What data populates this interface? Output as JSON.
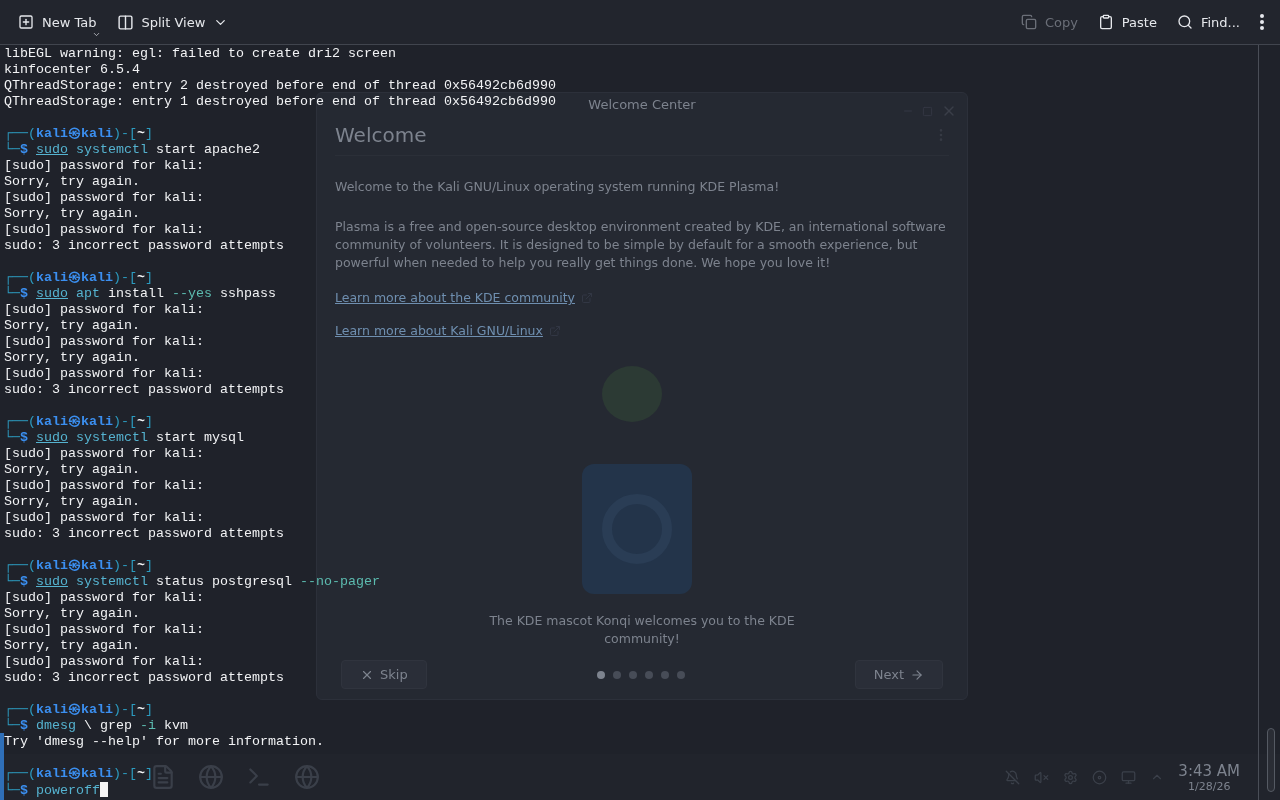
{
  "toolbar": {
    "new_tab": {
      "label": "New Tab"
    },
    "split_view": {
      "label": "Split View"
    },
    "actions": [
      {
        "kind": "copy",
        "label": "Copy",
        "disabled": true
      },
      {
        "kind": "paste",
        "label": "Paste",
        "disabled": false
      },
      {
        "kind": "find",
        "label": "Find...",
        "disabled": false
      }
    ]
  },
  "terminal": {
    "lines": [
      {
        "kind": "output",
        "text": "libEGL warning: egl: failed to create dri2 screen"
      },
      {
        "kind": "output",
        "text": "kinfocenter 6.5.4"
      },
      {
        "kind": "output",
        "text": "QThreadStorage: entry 2 destroyed before end of thread 0x56492cb6d990"
      },
      {
        "kind": "output",
        "text": "QThreadStorage: entry 1 destroyed before end of thread 0x56492cb6d990"
      },
      {
        "kind": "blank"
      },
      {
        "kind": "prompt",
        "open": "┌──(",
        "user": "kali㉿kali",
        "mid": ")-[",
        "dir": "~",
        "close": "]",
        "corner": "└─",
        "symbol": "$",
        "cursor": false,
        "command": [
          {
            "kind": "sudo",
            "text": "sudo"
          },
          {
            "kind": "program",
            "text": "systemctl"
          },
          {
            "kind": "arg",
            "text": "start apache2"
          }
        ]
      },
      {
        "kind": "output",
        "text": "[sudo] password for kali:"
      },
      {
        "kind": "output",
        "text": "Sorry, try again."
      },
      {
        "kind": "output",
        "text": "[sudo] password for kali:"
      },
      {
        "kind": "output",
        "text": "Sorry, try again."
      },
      {
        "kind": "output",
        "text": "[sudo] password for kali:"
      },
      {
        "kind": "output",
        "text": "sudo: 3 incorrect password attempts"
      },
      {
        "kind": "blank"
      },
      {
        "kind": "prompt",
        "open": "┌──(",
        "user": "kali㉿kali",
        "mid": ")-[",
        "dir": "~",
        "close": "]",
        "corner": "└─",
        "symbol": "$",
        "cursor": false,
        "command": [
          {
            "kind": "sudo",
            "text": "sudo"
          },
          {
            "kind": "program",
            "text": "apt"
          },
          {
            "kind": "arg",
            "text": "install"
          },
          {
            "kind": "option",
            "text": "--yes"
          },
          {
            "kind": "arg",
            "text": "sshpass"
          }
        ]
      },
      {
        "kind": "output",
        "text": "[sudo] password for kali:"
      },
      {
        "kind": "output",
        "text": "Sorry, try again."
      },
      {
        "kind": "output",
        "text": "[sudo] password for kali:"
      },
      {
        "kind": "output",
        "text": "Sorry, try again."
      },
      {
        "kind": "output",
        "text": "[sudo] password for kali:"
      },
      {
        "kind": "output",
        "text": "sudo: 3 incorrect password attempts"
      },
      {
        "kind": "blank"
      },
      {
        "kind": "prompt",
        "open": "┌──(",
        "user": "kali㉿kali",
        "mid": ")-[",
        "dir": "~",
        "close": "]",
        "corner": "└─",
        "symbol": "$",
        "cursor": false,
        "command": [
          {
            "kind": "sudo",
            "text": "sudo"
          },
          {
            "kind": "program",
            "text": "systemctl"
          },
          {
            "kind": "arg",
            "text": "start mysql"
          }
        ]
      },
      {
        "kind": "output",
        "text": "[sudo] password for kali:"
      },
      {
        "kind": "output",
        "text": "Sorry, try again."
      },
      {
        "kind": "output",
        "text": "[sudo] password for kali:"
      },
      {
        "kind": "output",
        "text": "Sorry, try again."
      },
      {
        "kind": "output",
        "text": "[sudo] password for kali:"
      },
      {
        "kind": "output",
        "text": "sudo: 3 incorrect password attempts"
      },
      {
        "kind": "blank"
      },
      {
        "kind": "prompt",
        "open": "┌──(",
        "user": "kali㉿kali",
        "mid": ")-[",
        "dir": "~",
        "close": "]",
        "corner": "└─",
        "symbol": "$",
        "cursor": false,
        "command": [
          {
            "kind": "sudo",
            "text": "sudo"
          },
          {
            "kind": "program",
            "text": "systemctl"
          },
          {
            "kind": "arg",
            "text": "status postgresql"
          },
          {
            "kind": "option",
            "text": "--no-pager"
          }
        ]
      },
      {
        "kind": "output",
        "text": "[sudo] password for kali:"
      },
      {
        "kind": "output",
        "text": "Sorry, try again."
      },
      {
        "kind": "output",
        "text": "[sudo] password for kali:"
      },
      {
        "kind": "output",
        "text": "Sorry, try again."
      },
      {
        "kind": "output",
        "text": "[sudo] password for kali:"
      },
      {
        "kind": "output",
        "text": "sudo: 3 incorrect password attempts"
      },
      {
        "kind": "blank"
      },
      {
        "kind": "prompt",
        "open": "┌──(",
        "user": "kali㉿kali",
        "mid": ")-[",
        "dir": "~",
        "close": "]",
        "corner": "└─",
        "symbol": "$",
        "cursor": false,
        "command": [
          {
            "kind": "program",
            "text": "dmesg"
          },
          {
            "kind": "arg",
            "text": "\\ grep"
          },
          {
            "kind": "option",
            "text": "-i"
          },
          {
            "kind": "arg",
            "text": "kvm"
          }
        ]
      },
      {
        "kind": "output",
        "text": "Try 'dmesg --help' for more information."
      },
      {
        "kind": "blank"
      },
      {
        "kind": "prompt",
        "open": "┌──(",
        "user": "kali㉿kali",
        "mid": ")-[",
        "dir": "~",
        "close": "]",
        "corner": "└─",
        "symbol": "$",
        "cursor": true,
        "command": [
          {
            "kind": "program",
            "text": "poweroff"
          }
        ]
      }
    ]
  },
  "welcome_window": {
    "title": "Welcome Center",
    "heading": "Welcome",
    "paragraphs": [
      "Welcome to the Kali GNU/Linux operating system running KDE Plasma!",
      "Plasma is a free and open-source desktop environment created by KDE, an international software community of volunteers. It is designed to be simple by default for a smooth experience, but powerful when needed to help you really get things done. We hope you love it!"
    ],
    "links": [
      "Learn more about the KDE community",
      "Learn more about Kali GNU/Linux"
    ],
    "caption": "The KDE mascot Konqi welcomes you to the KDE community!",
    "skip": "Skip",
    "next": "Next",
    "pages": [
      {
        "selected": true
      },
      {
        "selected": false
      },
      {
        "selected": false
      },
      {
        "selected": false
      },
      {
        "selected": false
      },
      {
        "selected": false
      }
    ]
  },
  "taskbar": {
    "time": "3:43 AM",
    "date": "1/28/26"
  }
}
